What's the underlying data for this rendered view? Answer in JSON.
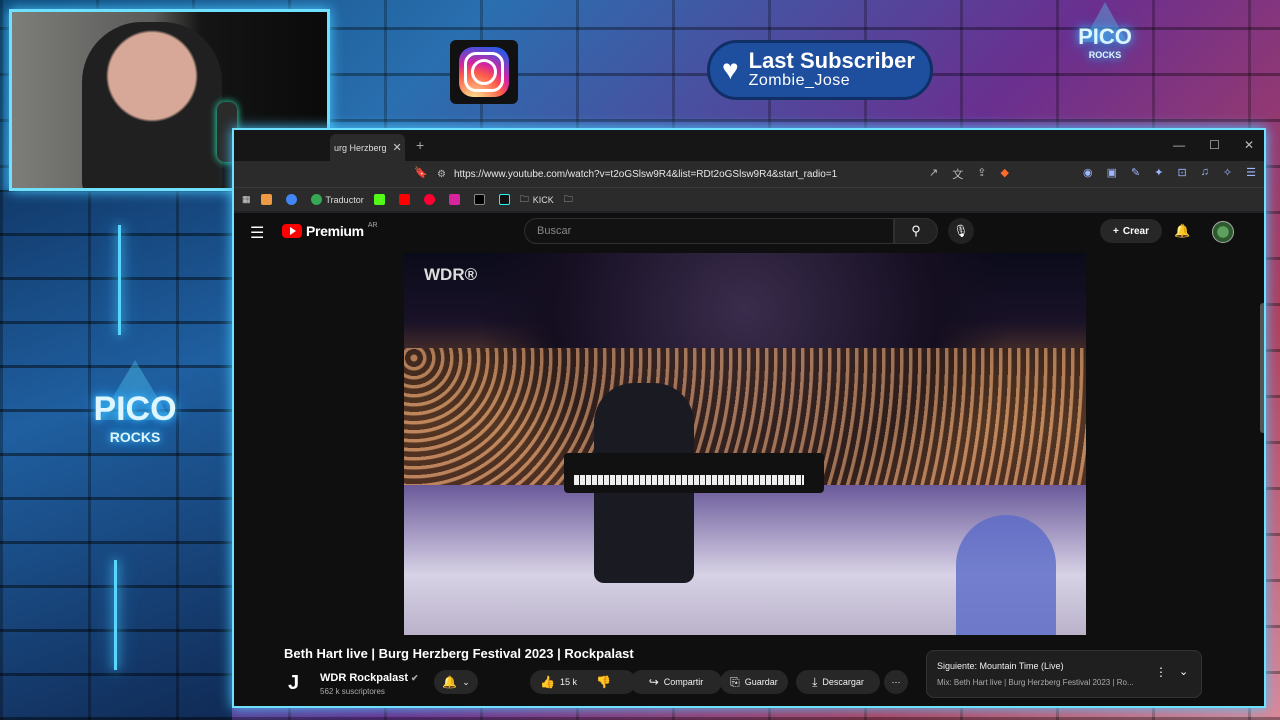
{
  "overlay": {
    "subscriber_label": "Last Subscriber",
    "subscriber_name": "Zombie_Jose",
    "brand_top": "PICO",
    "brand_sub": "ROCKS",
    "brand_side": "PICO",
    "brand_side_sub": "ROCKS",
    "accent_color": "#58d6ff"
  },
  "browser": {
    "tab_title": "urg Herzberg",
    "url": "https://www.youtube.com/watch?v=t2oGSlsw9R4&list=RDt2oGSlsw9R4&start_radio=1",
    "bookmarks": [
      {
        "label": ""
      },
      {
        "label": ""
      },
      {
        "label": "Traductor"
      },
      {
        "label": ""
      },
      {
        "label": ""
      },
      {
        "label": ""
      },
      {
        "label": ""
      },
      {
        "label": ""
      },
      {
        "label": "KICK"
      },
      {
        "label": ""
      }
    ]
  },
  "youtube": {
    "brand": "Premium",
    "country": "AR",
    "search_placeholder": "Buscar",
    "create_label": "Crear",
    "video_title": "Beth Hart live | Burg Herzberg Festival 2023 | Rockpalast",
    "watermark": "WDR®",
    "channel_name": "WDR Rockpalast",
    "channel_subs": "562 k suscriptores",
    "likes": "15 k",
    "share_label": "Compartir",
    "save_label": "Guardar",
    "download_label": "Descargar",
    "next_title": "Siguiente: Mountain Time (Live)",
    "next_sub": "Mix: Beth Hart live | Burg Herzberg Festival 2023 | Ro..."
  }
}
